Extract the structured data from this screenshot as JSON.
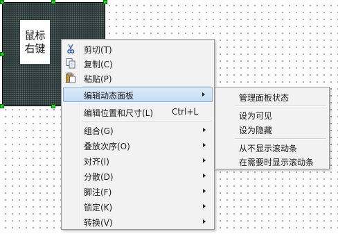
{
  "panel": {
    "label": "鼠标\n右键"
  },
  "menu": {
    "items": [
      {
        "label": "剪切(T)",
        "icon": "scissors-icon"
      },
      {
        "label": "复制(C)",
        "icon": "copy-icon"
      },
      {
        "label": "粘贴(P)",
        "icon": "paste-icon"
      },
      {
        "label": "编辑动态面板",
        "submenu": true
      },
      {
        "label": "编辑位置和尺寸(L)",
        "shortcut": "Ctrl+L"
      },
      {
        "label": "组合(G)",
        "submenu": true
      },
      {
        "label": "叠放次序(O)",
        "submenu": true
      },
      {
        "label": "对齐(I)",
        "submenu": true
      },
      {
        "label": "分散(D)",
        "submenu": true
      },
      {
        "label": "脚注(F)",
        "submenu": true
      },
      {
        "label": "锁定(K)",
        "submenu": true
      },
      {
        "label": "转换(V)",
        "submenu": true
      }
    ]
  },
  "submenu": {
    "items": [
      {
        "label": "管理面板状态"
      },
      {
        "label": "设为可见"
      },
      {
        "label": "设为隐藏"
      },
      {
        "label": "从不显示滚动条"
      },
      {
        "label": "在需要时显示滚动条"
      }
    ]
  },
  "colors": {
    "highlight": "#c3dcf5",
    "selection_handle": "#20d020"
  }
}
